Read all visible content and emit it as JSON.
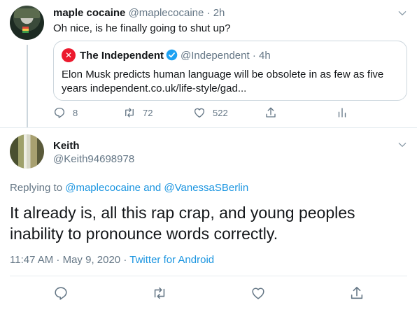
{
  "parent_tweet": {
    "display_name": "maple cocaine",
    "handle": "@maplecocaine",
    "separator": "·",
    "time": "2h",
    "text": "Oh nice, is he finally going to shut up?",
    "quoted": {
      "display_name": "The Independent",
      "handle": "@Independent",
      "separator": "·",
      "time": "4h",
      "text": "Elon Musk predicts human language will be obsolete in as few as five years independent.co.uk/life-style/gad..."
    },
    "actions": {
      "replies": "8",
      "retweets": "72",
      "likes": "522"
    }
  },
  "main_tweet": {
    "display_name": "Keith",
    "handle": "@Keith94698978",
    "replying_prefix": "Replying to",
    "replying_user1": "@maplecocaine",
    "replying_and": "and",
    "replying_user2": "@VanessaSBerlin",
    "text": "It already is, all this rap crap, and young peoples inability to pronounce words correctly.",
    "timestamp": "11:47 AM · May 9, 2020",
    "meta_separator": "·",
    "source": "Twitter for Android"
  },
  "icons": {
    "reply": "reply-icon",
    "retweet": "retweet-icon",
    "like": "heart-icon",
    "share": "share-icon",
    "analytics": "analytics-icon",
    "more": "chevron-down-icon",
    "verified": "verified-badge-icon"
  },
  "colors": {
    "link": "#1b95e0",
    "muted": "#657786",
    "brand_independent": "#ec1a2e"
  }
}
